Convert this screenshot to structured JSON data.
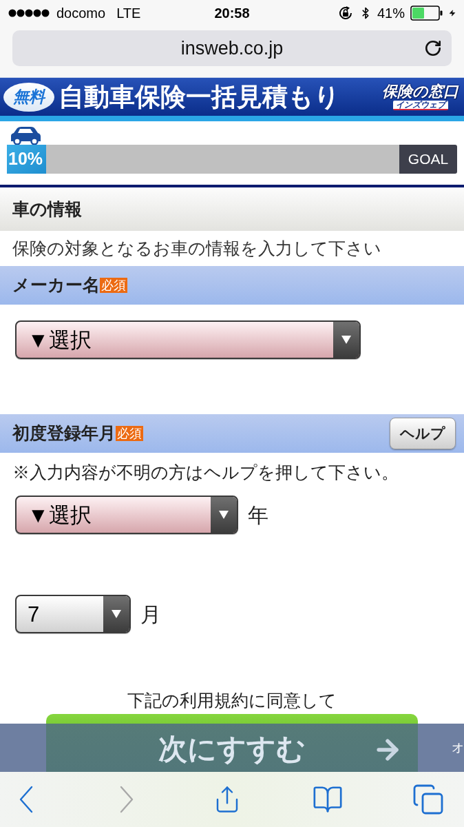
{
  "status_bar": {
    "carrier": "docomo",
    "network": "LTE",
    "time": "20:58",
    "battery_percent": "41%"
  },
  "address_bar": {
    "url": "insweb.co.jp"
  },
  "banner": {
    "badge": "無料",
    "title": "自動車保険一括見積もり",
    "logo_top": "保険の窓口",
    "logo_bottom": "インズウェブ"
  },
  "progress": {
    "label": "10%",
    "level": 0.1,
    "goal": "GOAL"
  },
  "section": {
    "title": "車の情報",
    "description": "保険の対象となるお車の情報を入力して下さい"
  },
  "fields": [
    {
      "label": "メーカー名",
      "badge": "必須",
      "selects": [
        {
          "kind": "maker",
          "value": "▼選択",
          "highlighted": true
        }
      ]
    },
    {
      "label": "初度登録年月",
      "badge": "必須",
      "help_button": "ヘルプ",
      "note": "※入力内容が不明の方はヘルプを押して下さい。",
      "selects": [
        {
          "kind": "year",
          "value": "▼選択",
          "highlighted": true,
          "unit": "年"
        },
        {
          "kind": "month",
          "value": "7",
          "highlighted": false,
          "unit": "月"
        }
      ]
    }
  ],
  "agreement": {
    "text": "下記の利用規約に同意して",
    "button": "次にすすむ"
  },
  "overlay_banner": {
    "text": "オ"
  },
  "toolbar": [
    {
      "kind": "back",
      "disabled": false
    },
    {
      "kind": "forward",
      "disabled": true
    },
    {
      "kind": "share",
      "disabled": false
    },
    {
      "kind": "bookmarks",
      "disabled": false
    },
    {
      "kind": "tabs",
      "disabled": false
    }
  ]
}
